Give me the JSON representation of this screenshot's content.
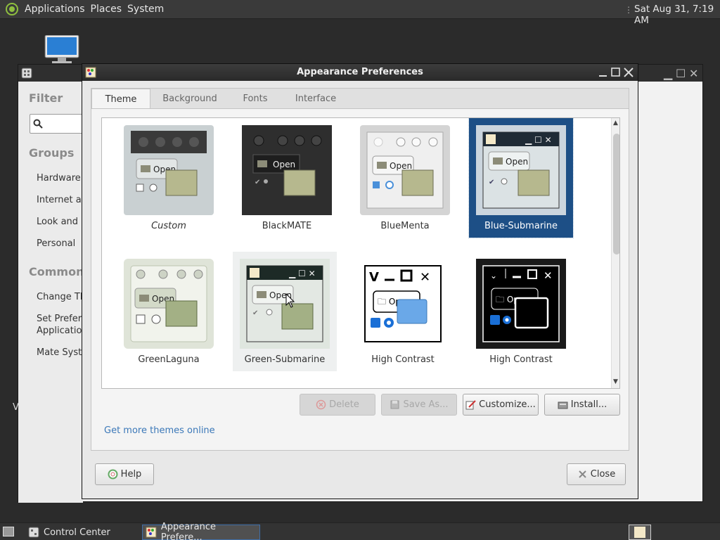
{
  "top_panel": {
    "menus": [
      "Applications",
      "Places",
      "System"
    ],
    "clock": "Sat Aug 31, 7:19 AM"
  },
  "control_center": {
    "sidebar": {
      "filter_heading": "Filter",
      "groups_heading": "Groups",
      "groups": [
        "Hardware",
        "Internet and Network",
        "Look and Feel",
        "Personal"
      ],
      "common_heading": "Common Tasks",
      "tasks": [
        "Change Theme",
        "Set Preferred",
        "Applications",
        "Mate System Monitor"
      ]
    }
  },
  "stray_text": "V",
  "dialog": {
    "title": "Appearance Preferences",
    "tabs": [
      "Theme",
      "Background",
      "Fonts",
      "Interface"
    ],
    "active_tab": "Theme",
    "themes": [
      {
        "name": "Custom",
        "style": "custom"
      },
      {
        "name": "BlackMATE",
        "style": "blackmate"
      },
      {
        "name": "BlueMenta",
        "style": "bluementa"
      },
      {
        "name": "Blue-Submarine",
        "style": "bluesub",
        "selected": true
      },
      {
        "name": "GreenLaguna",
        "style": "greenlaguna"
      },
      {
        "name": "Green-Submarine",
        "style": "greensub"
      },
      {
        "name": "High Contrast",
        "style": "hc"
      },
      {
        "name": "High Contrast",
        "style": "hci"
      }
    ],
    "thumb_open_label": "Open",
    "buttons": {
      "delete": "Delete",
      "save_as": "Save As...",
      "customize": "Customize...",
      "install": "Install...",
      "help": "Help",
      "close": "Close"
    },
    "more_themes_link": "Get more themes online"
  },
  "taskbar": {
    "tasks": [
      "Control Center",
      "Appearance Prefere..."
    ]
  },
  "colors": {
    "selection": "#1d4f86",
    "link": "#3b78b8"
  }
}
